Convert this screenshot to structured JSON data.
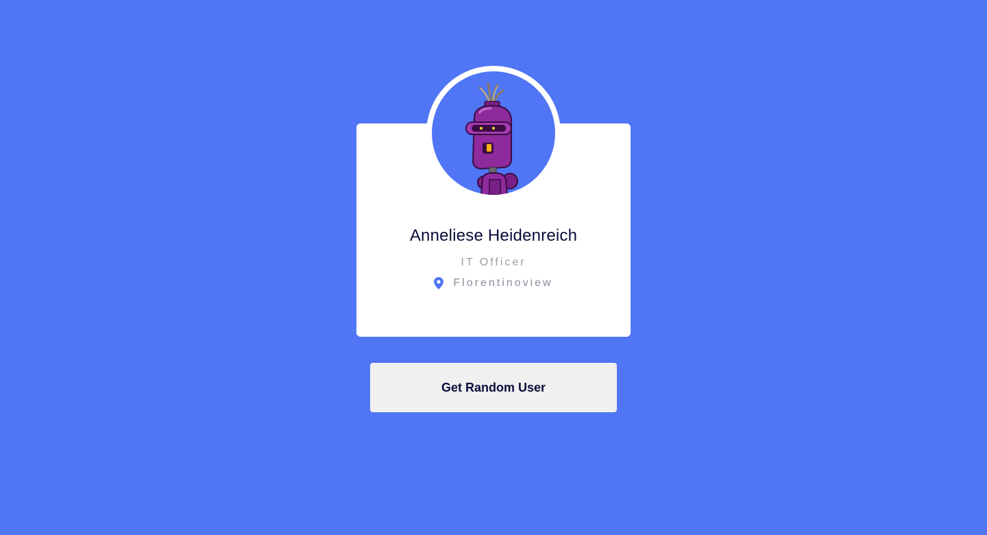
{
  "user": {
    "name": "Anneliese Heidenreich",
    "job_title": "IT Officer",
    "location": "Florentinoview",
    "avatar": "purple-robot-avatar"
  },
  "actions": {
    "random_user_label": "Get Random User"
  },
  "icons": {
    "location": "map-pin-icon"
  },
  "colors": {
    "background": "#5075f5",
    "card": "#ffffff",
    "name_text": "#0b0b3b",
    "muted_text": "#9a9aa2",
    "button_bg": "#f0f0f0",
    "accent": "#5075f5",
    "robot": "#8e2a9c"
  }
}
